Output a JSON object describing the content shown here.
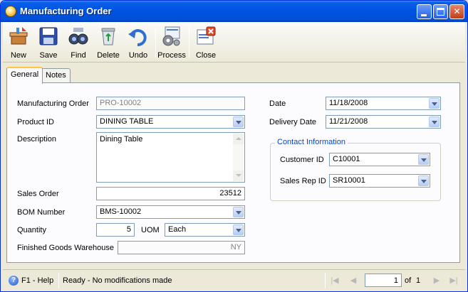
{
  "window": {
    "title": "Manufacturing Order"
  },
  "toolbar": {
    "new": "New",
    "save": "Save",
    "find": "Find",
    "delete": "Delete",
    "undo": "Undo",
    "process": "Process",
    "close": "Close"
  },
  "tabs": {
    "general": "General",
    "notes": "Notes"
  },
  "form": {
    "manufacturing_order": {
      "label": "Manufacturing Order",
      "value": "PRO-10002"
    },
    "product_id": {
      "label": "Product ID",
      "value": "DINING TABLE"
    },
    "description": {
      "label": "Description",
      "value": "Dining Table"
    },
    "sales_order": {
      "label": "Sales Order",
      "value": "23512"
    },
    "bom_number": {
      "label": "BOM Number",
      "value": "BMS-10002"
    },
    "quantity": {
      "label": "Quantity",
      "value": "5"
    },
    "uom": {
      "label": "UOM",
      "value": "Each"
    },
    "finished_goods_warehouse": {
      "label": "Finished Goods Warehouse",
      "value": "NY"
    },
    "date": {
      "label": "Date",
      "value": "11/18/2008"
    },
    "delivery_date": {
      "label": "Delivery Date",
      "value": "11/21/2008"
    },
    "contact": {
      "title": "Contact Information",
      "customer_id": {
        "label": "Customer ID",
        "value": "C10001"
      },
      "sales_rep_id": {
        "label": "Sales Rep ID",
        "value": "SR10001"
      }
    }
  },
  "status": {
    "help": "F1 - Help",
    "message": "Ready - No modifications made",
    "page": "1",
    "of_label": "of",
    "total": "1"
  }
}
